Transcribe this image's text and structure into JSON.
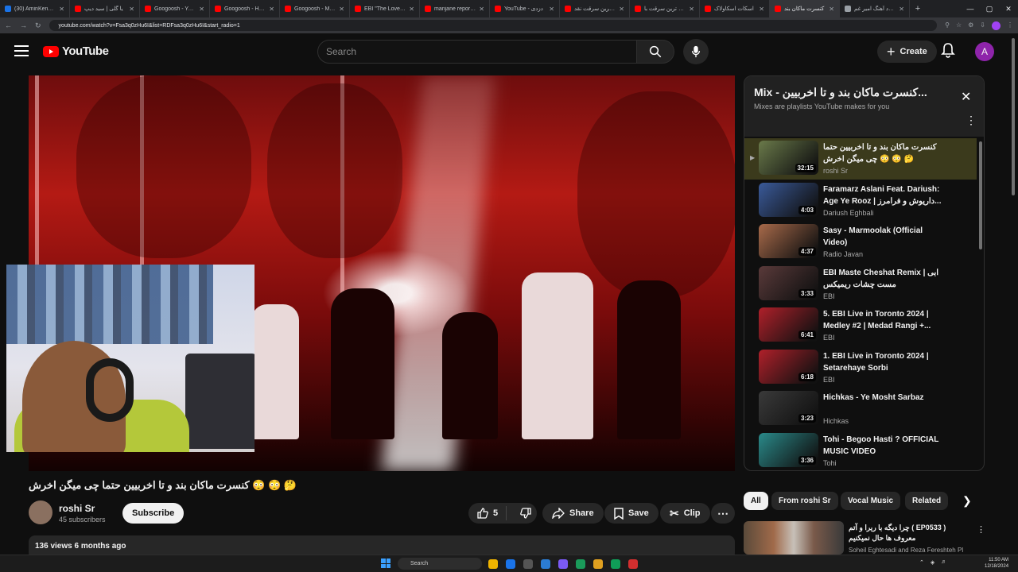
{
  "browser": {
    "tabs": [
      {
        "label": "(30) AminKenzi - Tu",
        "color": "#1a73e8",
        "active": false
      },
      {
        "label": "یا گلی | سید دیپ",
        "color": "#ff0000",
        "active": false
      },
      {
        "label": "Googoosh - YouTub",
        "color": "#ff0000",
        "active": false
      },
      {
        "label": "Googoosh - Hamsa",
        "color": "#ff0000",
        "active": false
      },
      {
        "label": "Googoosh - Mano",
        "color": "#ff0000",
        "active": false
      },
      {
        "label": "EBI \"The Love Proje",
        "color": "#ff0000",
        "active": false
      },
      {
        "label": "manjane reports -",
        "color": "#ff0000",
        "active": false
      },
      {
        "label": "YouTube - دزدی",
        "color": "#ff0000",
        "active": false
      },
      {
        "label": "بزرگترین سرقت نقد",
        "color": "#ff0000",
        "active": false
      },
      {
        "label": "عجیب ترین سرقت با",
        "color": "#ff0000",
        "active": false
      },
      {
        "label": "اسکات اسکاولاک",
        "color": "#ff0000",
        "active": false
      },
      {
        "label": "کنسرت ماکان بند",
        "color": "#ff0000",
        "active": true
      },
      {
        "label": "دانلود آهنگ امیر غم",
        "color": "#9aa0a6",
        "active": false
      }
    ],
    "new_tab": "+",
    "url": "youtube.com/watch?v=Fsa3q0zHu6I&list=RDFsa3q0zHu6I&start_radio=1"
  },
  "header": {
    "logo_text": "YouTube",
    "search_placeholder": "Search",
    "create_label": "Create",
    "avatar_letter": "A"
  },
  "video": {
    "title": "کنسرت ماکان بند و تا اخربیین حتما چی میگن اخرش 😳 😳 🤔",
    "channel": "roshi Sr",
    "subscribers": "45 subscribers",
    "subscribe_label": "Subscribe",
    "likes": "5",
    "share_label": "Share",
    "save_label": "Save",
    "clip_label": "Clip",
    "views_date": "136 views  6 months ago"
  },
  "playlist": {
    "title": "Mix - کنسرت ماکان بند و تا اخربیین...",
    "subtitle": "Mixes are playlists YouTube makes for you",
    "items": [
      {
        "title": "کنسرت ماکان بند و تا اخربیین حتما چی میگن اخرش 😳 😳 🤔",
        "channel": "roshi Sr",
        "duration": "32:15",
        "thumb": "#6a7a4a",
        "active": true
      },
      {
        "title": "Faramarz Aslani Feat. Dariush: Age Ye Rooz | داریوش و فرامرز...",
        "channel": "Dariush Eghbali",
        "duration": "4:03",
        "thumb": "#3a5a9a",
        "active": false
      },
      {
        "title": "Sasy - Marmoolak (Official Video)",
        "channel": "Radio Javan",
        "duration": "4:37",
        "thumb": "#a86a4a",
        "active": false
      },
      {
        "title": "EBI Maste Cheshat Remix | ابی مست چشات ریمیکس",
        "channel": "EBI",
        "duration": "3:33",
        "thumb": "#5a3a3a",
        "active": false
      },
      {
        "title": "5. EBI Live in Toronto 2024 | Medley #2 | Medad Rangi +...",
        "channel": "EBI",
        "duration": "6:41",
        "thumb": "#b0202a",
        "active": false
      },
      {
        "title": "1. EBI Live in Toronto 2024 | Setarehaye Sorbi",
        "channel": "EBI",
        "duration": "6:18",
        "thumb": "#b0202a",
        "active": false
      },
      {
        "title": "Hichkas - Ye Mosht Sarbaz",
        "channel": "Hichkas",
        "duration": "3:23",
        "thumb": "#3a3a3a",
        "active": false
      },
      {
        "title": "Tohi - Begoo Hasti ? OFFICIAL MUSIC VIDEO",
        "channel": "Tohi",
        "duration": "3:36",
        "thumb": "#2a8a8a",
        "active": false
      }
    ]
  },
  "chips": [
    "All",
    "From roshi Sr",
    "Vocal Music",
    "Related"
  ],
  "related": {
    "title": "چرا دیگه با ریرا و آتم ( EP0533 ) معروف ها حال نمیکنیم",
    "channel": "Soheil Eghtesadi and Reza Fereshteh Pl"
  },
  "taskbar": {
    "search_label": "Search",
    "time": "11:50 AM",
    "date": "12/18/2024",
    "icons": [
      "#f0b400",
      "#1a73e8",
      "#555",
      "#2b7cd3",
      "#7a5af5",
      "#1a9a5a",
      "#e0a020",
      "#0f9d58",
      "#d32f2f"
    ]
  }
}
